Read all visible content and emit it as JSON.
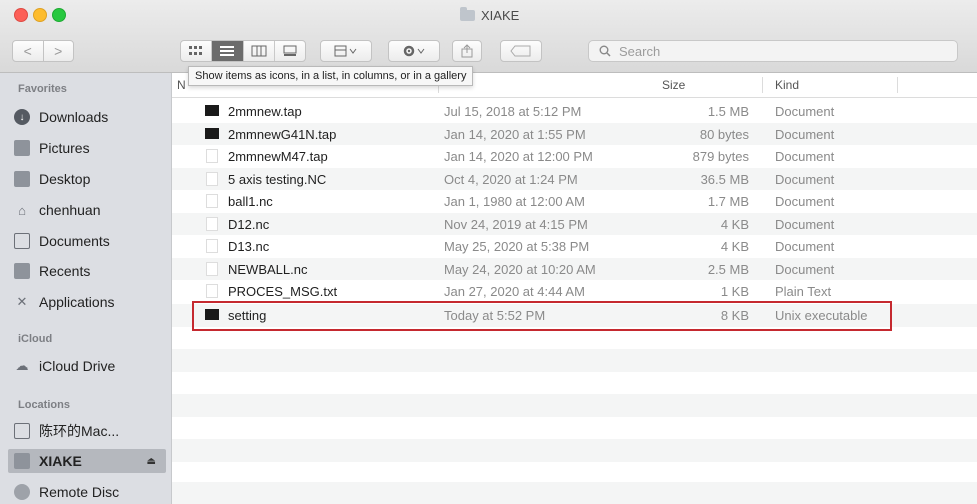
{
  "window": {
    "title": "XIAKE"
  },
  "toolbar": {
    "back_label": "<",
    "forward_label": ">",
    "tooltip": "Show items as icons, in a list, in columns, or in a gallery"
  },
  "search": {
    "placeholder": "Search",
    "value": ""
  },
  "sidebar": {
    "favorites_heading": "Favorites",
    "favorites": [
      {
        "label": "Downloads",
        "icon": "download-icon"
      },
      {
        "label": "Pictures",
        "icon": "pictures-icon"
      },
      {
        "label": "Desktop",
        "icon": "desktop-icon"
      },
      {
        "label": "chenhuan",
        "icon": "home-icon"
      },
      {
        "label": "Documents",
        "icon": "documents-icon"
      },
      {
        "label": "Recents",
        "icon": "recents-icon"
      },
      {
        "label": "Applications",
        "icon": "applications-icon"
      }
    ],
    "icloud_heading": "iCloud",
    "icloud": [
      {
        "label": "iCloud Drive",
        "icon": "cloud-icon"
      }
    ],
    "locations_heading": "Locations",
    "locations": [
      {
        "label": "陈环的Mac...",
        "icon": "computer-icon"
      },
      {
        "label": "XIAKE",
        "icon": "drive-icon",
        "selected": true
      },
      {
        "label": "Remote Disc",
        "icon": "disc-icon"
      }
    ]
  },
  "columns": {
    "name": "N",
    "size": "Size",
    "kind": "Kind"
  },
  "files": [
    {
      "name": "2mmnew.tap",
      "date": "Jul 15, 2018 at 5:12 PM",
      "size": "1.5 MB",
      "kind": "Document",
      "icon": "black-file-icon"
    },
    {
      "name": "2mmnewG41N.tap",
      "date": "Jan 14, 2020 at 1:55 PM",
      "size": "80 bytes",
      "kind": "Document",
      "icon": "black-file-icon"
    },
    {
      "name": "2mmnewM47.tap",
      "date": "Jan 14, 2020 at 12:00 PM",
      "size": "879 bytes",
      "kind": "Document",
      "icon": "white-file-icon"
    },
    {
      "name": "5 axis testing.NC",
      "date": "Oct 4, 2020 at 1:24 PM",
      "size": "36.5 MB",
      "kind": "Document",
      "icon": "white-file-icon"
    },
    {
      "name": "ball1.nc",
      "date": "Jan 1, 1980 at 12:00 AM",
      "size": "1.7 MB",
      "kind": "Document",
      "icon": "white-file-icon"
    },
    {
      "name": "D12.nc",
      "date": "Nov 24, 2019 at 4:15 PM",
      "size": "4 KB",
      "kind": "Document",
      "icon": "white-file-icon"
    },
    {
      "name": "D13.nc",
      "date": "May 25, 2020 at 5:38 PM",
      "size": "4 KB",
      "kind": "Document",
      "icon": "white-file-icon"
    },
    {
      "name": "NEWBALL.nc",
      "date": "May 24, 2020 at 10:20 AM",
      "size": "2.5 MB",
      "kind": "Document",
      "icon": "white-file-icon"
    },
    {
      "name": "PROCES_MSG.txt",
      "date": "Jan 27, 2020 at 4:44 AM",
      "size": "1 KB",
      "kind": "Plain Text",
      "icon": "white-file-icon"
    },
    {
      "name": "setting",
      "date": "Today at 5:52 PM",
      "size": "8 KB",
      "kind": "Unix executable",
      "icon": "black-file-icon"
    }
  ],
  "colors": {
    "highlight": "#c5292f",
    "sidebar_bg": "#dcdee3",
    "selected_bg": "#b5b8be"
  }
}
